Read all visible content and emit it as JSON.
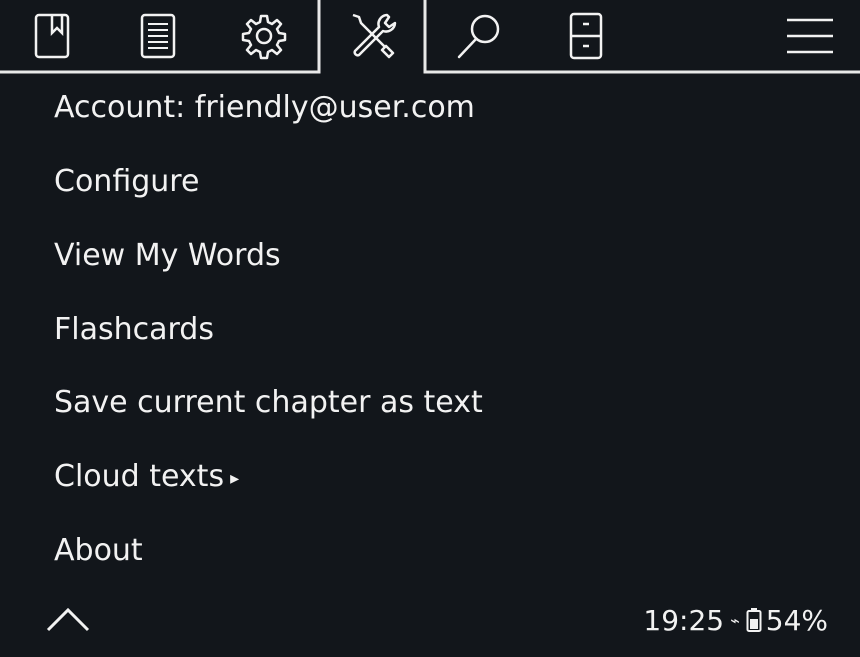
{
  "tabs": [
    {
      "name": "bookmark-icon"
    },
    {
      "name": "toc-list-icon"
    },
    {
      "name": "gear-icon"
    },
    {
      "name": "tools-icon",
      "active": true
    },
    {
      "name": "search-icon"
    },
    {
      "name": "file-cabinet-icon"
    },
    {
      "name": "hamburger-menu-icon"
    }
  ],
  "menu": {
    "items": [
      {
        "label": "Account: friendly@user.com"
      },
      {
        "label": "Configure"
      },
      {
        "label": "View My Words"
      },
      {
        "label": "Flashcards"
      },
      {
        "label": "Save current chapter as text"
      },
      {
        "label": "Cloud texts",
        "submenu_arrow": "▸"
      },
      {
        "label": "About"
      }
    ]
  },
  "footer": {
    "up_icon": "chevron-up-icon",
    "time": "19:25",
    "wifi_glyph": "⌁",
    "battery_icon": "battery-icon",
    "battery": "54%"
  },
  "colors": {
    "background": "#12161b",
    "foreground": "#f2f2f2",
    "tab_border": "#e8e8e8"
  }
}
